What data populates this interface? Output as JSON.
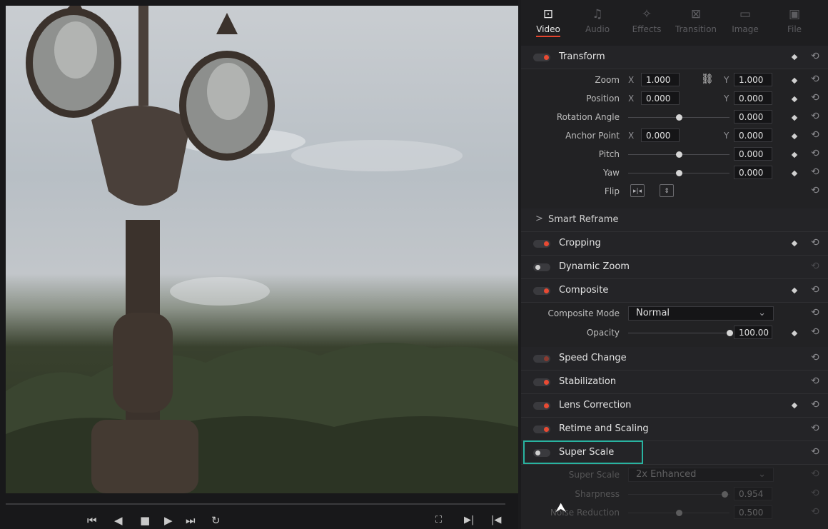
{
  "tabs": [
    {
      "label": "Video",
      "icon": "film-icon",
      "glyph": "⊡"
    },
    {
      "label": "Audio",
      "icon": "music-note-icon",
      "glyph": "♫"
    },
    {
      "label": "Effects",
      "icon": "magic-wand-icon",
      "glyph": "✧"
    },
    {
      "label": "Transition",
      "icon": "transition-icon",
      "glyph": "⊠"
    },
    {
      "label": "Image",
      "icon": "image-icon",
      "glyph": "▭"
    },
    {
      "label": "File",
      "icon": "file-icon",
      "glyph": "▣"
    }
  ],
  "transform": {
    "title": "Transform",
    "zoom": {
      "label": "Zoom",
      "x_axis": "X",
      "x": "1.000",
      "y_axis": "Y",
      "y": "1.000"
    },
    "position": {
      "label": "Position",
      "x_axis": "X",
      "x": "0.000",
      "y_axis": "Y",
      "y": "0.000"
    },
    "rotation": {
      "label": "Rotation Angle",
      "value": "0.000",
      "level": 0.5
    },
    "anchor": {
      "label": "Anchor Point",
      "x_axis": "X",
      "x": "0.000",
      "y_axis": "Y",
      "y": "0.000"
    },
    "pitch": {
      "label": "Pitch",
      "value": "0.000",
      "level": 0.5
    },
    "yaw": {
      "label": "Yaw",
      "value": "0.000",
      "level": 0.5
    },
    "flip": {
      "label": "Flip"
    }
  },
  "smart_reframe": {
    "title": "Smart Reframe",
    "chevron": ">"
  },
  "sections": {
    "cropping": "Cropping",
    "dynamic_zoom": "Dynamic Zoom",
    "composite": "Composite",
    "speed_change": "Speed Change",
    "stabilization": "Stabilization",
    "lens_correction": "Lens Correction",
    "retime_scaling": "Retime and Scaling",
    "super_scale": "Super Scale"
  },
  "composite": {
    "mode_label": "Composite Mode",
    "mode_value": "Normal",
    "opacity_label": "Opacity",
    "opacity_value": "100.00",
    "opacity_level": 1.0
  },
  "super_scale": {
    "scale_label": "Super Scale",
    "scale_value": "2x Enhanced",
    "sharpness_label": "Sharpness",
    "sharpness_value": "0.954",
    "sharpness_level": 0.954,
    "noise_label": "Noise Reduction",
    "noise_value": "0.500",
    "noise_level": 0.5
  },
  "colors": {
    "accent": "#e3442e",
    "highlight": "#29b3a0"
  }
}
